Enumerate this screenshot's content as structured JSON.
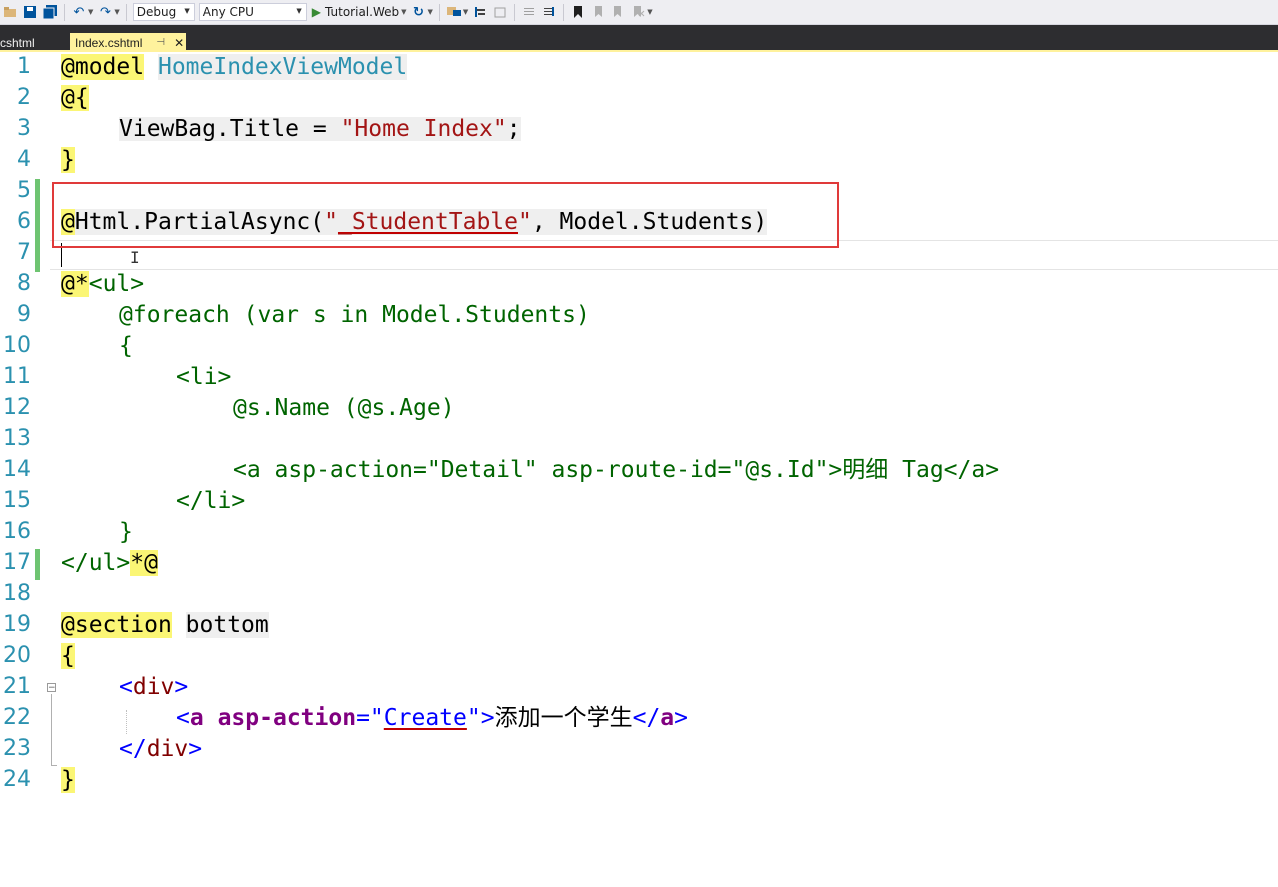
{
  "toolbar": {
    "configuration": "Debug",
    "platform": "Any CPU",
    "run_target": "Tutorial.Web",
    "icons": [
      "open-folder-icon",
      "save-icon",
      "save-all-icon",
      "undo-icon",
      "redo-icon",
      "play-icon",
      "refresh-icon",
      "browser-link-icon",
      "step-into-icon",
      "step-out-icon",
      "comment-icon",
      "uncomment-icon",
      "bookmark-icon",
      "bookmark-prev-icon",
      "bookmark-next-icon",
      "bookmark-clear-icon"
    ]
  },
  "tabs": {
    "inactive_label": "cshtml",
    "active_label": "Index.cshtml",
    "active_color": "#fff29d"
  },
  "gutter": {
    "numbers": [
      "1",
      "2",
      "3",
      "4",
      "5",
      "6",
      "7",
      "8",
      "9",
      "10",
      "11",
      "12",
      "13",
      "14",
      "15",
      "16",
      "17",
      "18",
      "19",
      "20",
      "21",
      "22",
      "23",
      "24"
    ]
  },
  "code": {
    "l1": {
      "at": "@",
      "kw": "model",
      "type": "HomeIndexViewModel"
    },
    "l2": {
      "at": "@",
      "brace": "{"
    },
    "l3": {
      "a": "ViewBag.Title = ",
      "str": "\"Home Index\"",
      "b": ";"
    },
    "l4": {
      "brace": "}"
    },
    "l6": {
      "at": "@",
      "a": "Html.PartialAsync(",
      "q1": "\"",
      "str": "_StudentTable",
      "q2": "\"",
      "b": ", Model.Students)"
    },
    "l8": {
      "at": "@",
      "star": "*",
      "rest": "<ul>"
    },
    "l9": "@foreach (var s in Model.Students)",
    "l10": "{",
    "l11": "<li>",
    "l12": "@s.Name (@s.Age)",
    "l14": "<a asp-action=\"Detail\" asp-route-id=\"@s.Id\">明细 Tag</a>",
    "l15": "</li>",
    "l16": "}",
    "l17": {
      "rest": "</ul>",
      "end": "*@"
    },
    "l19": {
      "at": "@",
      "kw": "section",
      "name": "bottom"
    },
    "l20": {
      "brace": "{"
    },
    "l21": {
      "open": "<",
      "tag": "div",
      "close": ">"
    },
    "l22": {
      "open": "<",
      "tag": "a",
      "attr": "asp-action",
      "eq": "=",
      "q1": "\"",
      "val": "Create",
      "q2": "\"",
      "close": ">",
      "text": "添加一个学生",
      "end_open": "</",
      "end_tag": "a",
      "end_close": ">"
    },
    "l23": {
      "open": "</",
      "tag": "div",
      "close": ">"
    },
    "l24": {
      "brace": "}"
    }
  },
  "colors": {
    "razor_marker": "#fbf675",
    "highlight_box": "#e03a3a",
    "change_bar": "#6ec471"
  }
}
